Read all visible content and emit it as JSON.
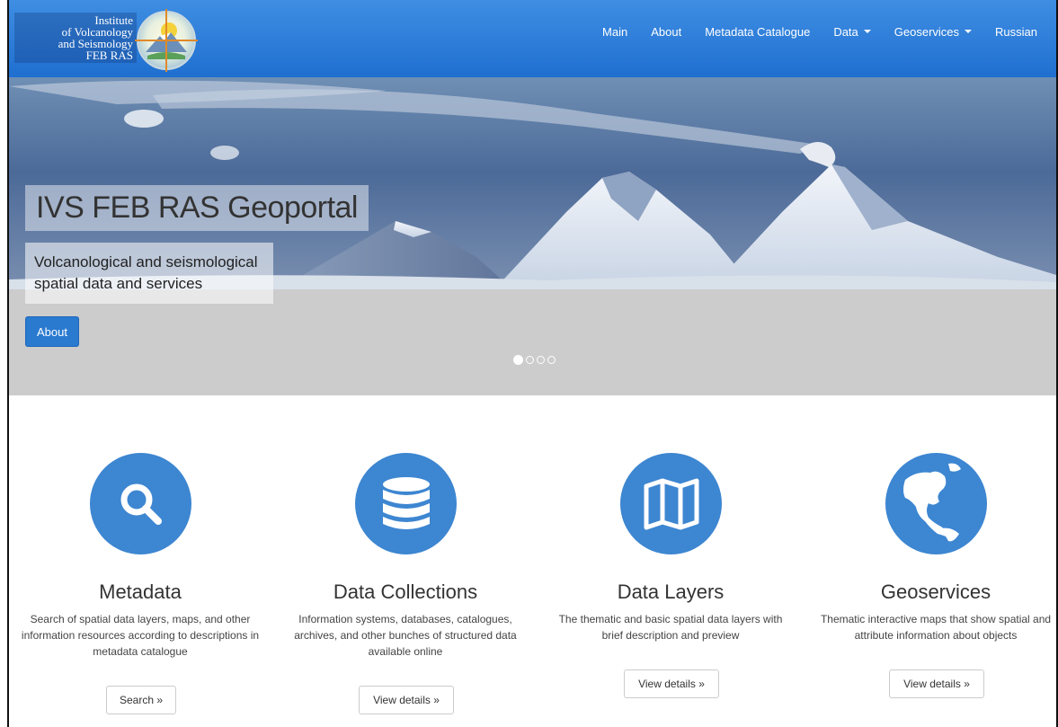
{
  "brand": {
    "lines": [
      "Institute",
      "of Volcanology",
      "and Seismology",
      "FEB RAS"
    ]
  },
  "nav": {
    "items": [
      {
        "label": "Main"
      },
      {
        "label": "About"
      },
      {
        "label": "Metadata Catalogue"
      },
      {
        "label": "Data",
        "dropdown": true
      },
      {
        "label": "Geoservices",
        "dropdown": true
      },
      {
        "label": "Russian"
      }
    ]
  },
  "hero": {
    "title": "IVS FEB RAS Geoportal",
    "subtitle": "Volcanological and seismological spatial data and services",
    "button_label": "About",
    "slides": 4,
    "active_slide": 1
  },
  "features": [
    {
      "icon": "search-icon",
      "title": "Metadata",
      "description": "Search of spatial data layers, maps, and other information resources according to descriptions in metadata catalogue",
      "button_label": "Search »"
    },
    {
      "icon": "database-icon",
      "title": "Data Collections",
      "description": "Information systems, databases, catalogues, archives, and other bunches of structured data available online",
      "button_label": "View details »"
    },
    {
      "icon": "map-icon",
      "title": "Data Layers",
      "description": "The thematic and basic spatial data layers with brief description and preview",
      "button_label": "View details »"
    },
    {
      "icon": "globe-icon",
      "title": "Geoservices",
      "description": "Thematic interactive maps that show spatial and attribute information about objects",
      "button_label": "View details »"
    }
  ],
  "colors": {
    "navbar": "#2a7ad8",
    "accent": "#3d86d1",
    "hero_bg": "#cccccc"
  }
}
